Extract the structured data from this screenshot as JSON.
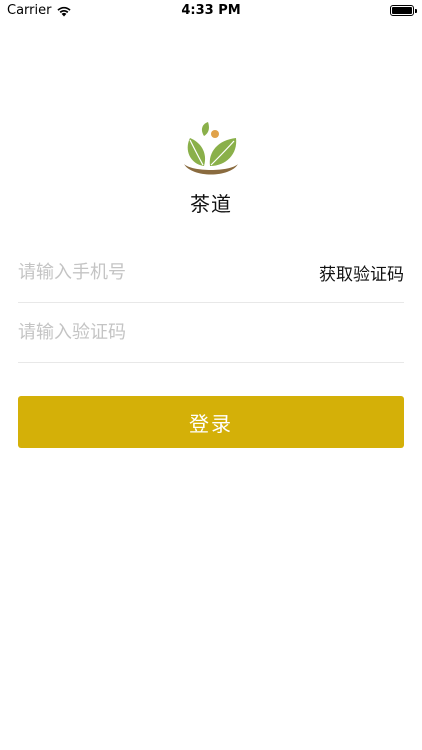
{
  "status_bar": {
    "carrier": "Carrier",
    "time": "4:33 PM",
    "wifi_icon": "wifi-icon",
    "battery_icon": "battery-icon"
  },
  "brand": {
    "app_name": "茶道",
    "logo_icon": "tea-leaf-logo",
    "leaf_color": "#8ab04a",
    "bowl_color": "#8a6b3f",
    "dot_color": "#e0a24a"
  },
  "form": {
    "phone_placeholder": "请输入手机号",
    "phone_value": "",
    "get_code_label": "获取验证码",
    "code_placeholder": "请输入验证码",
    "code_value": ""
  },
  "login": {
    "label": "登录",
    "color": "#d4b008"
  }
}
